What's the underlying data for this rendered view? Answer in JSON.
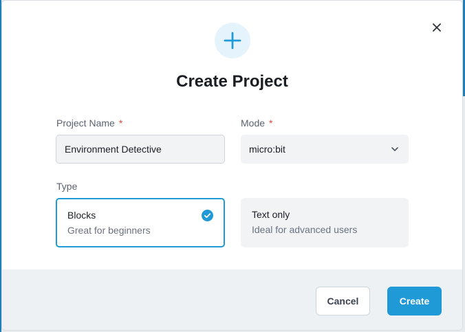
{
  "dialog": {
    "title": "Create Project",
    "icons": {
      "header": "plus-icon",
      "close": "close-icon"
    }
  },
  "form": {
    "project_name": {
      "label": "Project Name",
      "required_marker": "*",
      "value": "Environment Detective"
    },
    "mode": {
      "label": "Mode",
      "required_marker": "*",
      "selected": "micro:bit"
    },
    "type": {
      "label": "Type",
      "options": [
        {
          "title": "Blocks",
          "subtitle": "Great for beginners",
          "selected": true
        },
        {
          "title": "Text only",
          "subtitle": "Ideal for advanced users",
          "selected": false
        }
      ]
    }
  },
  "footer": {
    "cancel_label": "Cancel",
    "create_label": "Create"
  },
  "colors": {
    "accent": "#1f9ad6",
    "required": "#e0453b",
    "field_bg": "#f1f3f5",
    "footer_bg": "#eef1f4"
  }
}
